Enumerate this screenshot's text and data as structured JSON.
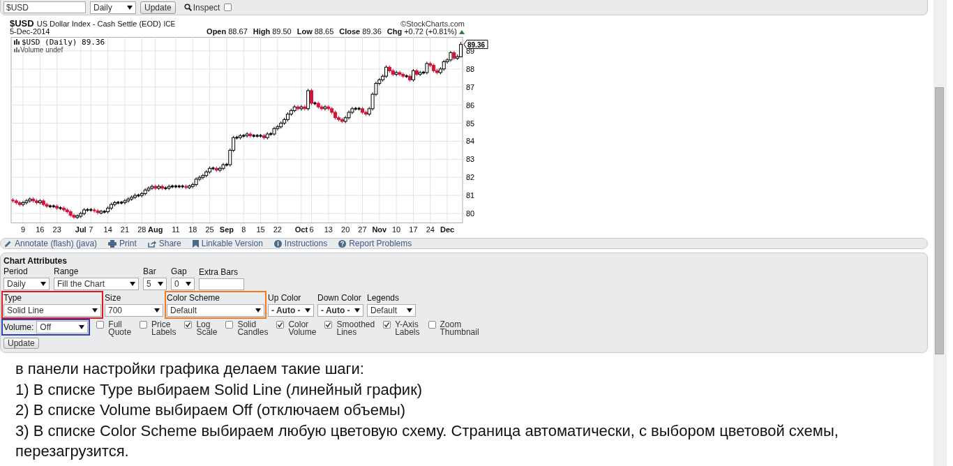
{
  "symbol_bar": {
    "symbol": "$USD",
    "period": "Daily",
    "update": "Update",
    "inspect": {
      "label": "Inspect",
      "checked": false
    }
  },
  "chart": {
    "symbol": "$USD",
    "name": "US Dollar Index - Cash Settle (EOD)",
    "exchange": "ICE",
    "credit": "©StockCharts.com",
    "date": "5-Dec-2014",
    "quote": [
      {
        "label": "Open",
        "value": "88.67"
      },
      {
        "label": "High",
        "value": "89.50"
      },
      {
        "label": "Low",
        "value": "88.65"
      },
      {
        "label": "Close",
        "value": "89.36"
      },
      {
        "label": "Chg",
        "value": "+0.72 (+0.81%)"
      }
    ],
    "change_up": true,
    "legend": "$USD (Daily) 89.36",
    "volume_legend": "Volume undef",
    "price_tag": "89.36",
    "chart_data": {
      "type": "candlestick",
      "grid": true,
      "ylim": [
        79.5,
        89.77
      ],
      "yticks": [
        80,
        81,
        82,
        83,
        84,
        85,
        86,
        87,
        88,
        89
      ],
      "categories": [
        null,
        null,
        null,
        "9",
        null,
        null,
        null,
        null,
        "16",
        null,
        null,
        null,
        null,
        "23",
        null,
        null,
        null,
        null,
        null,
        null,
        "**Jul**",
        null,
        null,
        "7",
        null,
        null,
        null,
        null,
        "14",
        null,
        null,
        null,
        null,
        "21",
        null,
        null,
        null,
        null,
        "28",
        null,
        null,
        null,
        "**Aug**",
        null,
        null,
        null,
        null,
        null,
        "11",
        null,
        null,
        null,
        null,
        "18",
        null,
        null,
        null,
        null,
        "25",
        null,
        null,
        null,
        null,
        "**Sep**",
        null,
        null,
        null,
        null,
        "8",
        null,
        null,
        null,
        null,
        "15",
        null,
        null,
        null,
        null,
        "22",
        null,
        null,
        null,
        null,
        null,
        null,
        "**Oct**",
        null,
        null,
        "6",
        null,
        null,
        null,
        null,
        "13",
        null,
        null,
        null,
        null,
        "20",
        null,
        null,
        null,
        null,
        "27",
        null,
        null,
        null,
        null,
        "**Nov**",
        null,
        null,
        null,
        null,
        "10",
        null,
        null,
        null,
        null,
        "17",
        null,
        null,
        null,
        null,
        "24",
        null,
        null,
        null,
        null,
        "**Dec**",
        null,
        null,
        null,
        null
      ],
      "ohlc": [
        [
          80.75,
          80.85,
          80.6,
          80.7
        ],
        [
          80.7,
          80.8,
          80.5,
          80.6
        ],
        [
          80.6,
          80.7,
          80.4,
          80.5
        ],
        [
          80.5,
          80.7,
          80.4,
          80.6
        ],
        [
          80.6,
          80.8,
          80.5,
          80.7
        ],
        [
          80.7,
          80.9,
          80.6,
          80.8
        ],
        [
          80.8,
          80.9,
          80.6,
          80.7
        ],
        [
          80.7,
          80.8,
          80.5,
          80.6
        ],
        [
          80.6,
          80.8,
          80.5,
          80.7
        ],
        [
          80.7,
          80.8,
          80.4,
          80.5
        ],
        [
          80.5,
          80.6,
          80.3,
          80.4
        ],
        [
          80.4,
          80.5,
          80.3,
          80.4
        ],
        [
          80.4,
          80.5,
          80.3,
          80.4
        ],
        [
          80.4,
          80.5,
          80.2,
          80.3
        ],
        [
          80.3,
          80.4,
          80.2,
          80.3
        ],
        [
          80.3,
          80.4,
          80.1,
          80.2
        ],
        [
          80.2,
          80.3,
          80.0,
          80.1
        ],
        [
          80.1,
          80.2,
          79.8,
          79.9
        ],
        [
          79.9,
          80.0,
          79.7,
          79.8
        ],
        [
          79.8,
          79.95,
          79.7,
          79.85
        ],
        [
          79.85,
          80.1,
          79.75,
          80.0
        ],
        [
          80.0,
          80.3,
          79.9,
          80.2
        ],
        [
          80.2,
          80.3,
          80.1,
          80.2
        ],
        [
          80.2,
          80.3,
          80.1,
          80.2
        ],
        [
          80.2,
          80.3,
          80.05,
          80.15
        ],
        [
          80.15,
          80.25,
          79.95,
          80.05
        ],
        [
          80.05,
          80.2,
          79.95,
          80.1
        ],
        [
          80.1,
          80.2,
          80.0,
          80.1
        ],
        [
          80.1,
          80.4,
          80.0,
          80.3
        ],
        [
          80.3,
          80.6,
          80.2,
          80.5
        ],
        [
          80.5,
          80.7,
          80.4,
          80.6
        ],
        [
          80.6,
          80.7,
          80.5,
          80.6
        ],
        [
          80.6,
          80.7,
          80.5,
          80.6
        ],
        [
          80.6,
          80.8,
          80.5,
          80.7
        ],
        [
          80.7,
          80.9,
          80.6,
          80.8
        ],
        [
          80.8,
          81.0,
          80.7,
          80.9
        ],
        [
          80.9,
          81.1,
          80.8,
          81.0
        ],
        [
          81.0,
          81.1,
          80.9,
          81.0
        ],
        [
          81.0,
          81.2,
          80.9,
          81.1
        ],
        [
          81.1,
          81.4,
          81.0,
          81.3
        ],
        [
          81.3,
          81.5,
          81.2,
          81.4
        ],
        [
          81.4,
          81.6,
          81.3,
          81.5
        ],
        [
          81.5,
          81.6,
          81.3,
          81.4
        ],
        [
          81.4,
          81.6,
          81.3,
          81.5
        ],
        [
          81.5,
          81.6,
          81.3,
          81.4
        ],
        [
          81.4,
          81.5,
          81.3,
          81.4
        ],
        [
          81.4,
          81.6,
          81.3,
          81.5
        ],
        [
          81.5,
          81.6,
          81.4,
          81.5
        ],
        [
          81.5,
          81.6,
          81.4,
          81.5
        ],
        [
          81.5,
          81.6,
          81.4,
          81.5
        ],
        [
          81.5,
          81.6,
          81.4,
          81.5
        ],
        [
          81.5,
          81.6,
          81.35,
          81.45
        ],
        [
          81.45,
          81.6,
          81.35,
          81.5
        ],
        [
          81.5,
          81.7,
          81.4,
          81.6
        ],
        [
          81.6,
          82.0,
          81.5,
          81.9
        ],
        [
          81.9,
          82.1,
          81.8,
          82.0
        ],
        [
          82.0,
          82.2,
          81.9,
          82.1
        ],
        [
          82.1,
          82.4,
          82.0,
          82.3
        ],
        [
          82.3,
          82.6,
          82.2,
          82.5
        ],
        [
          82.5,
          82.6,
          82.4,
          82.5
        ],
        [
          82.5,
          82.6,
          82.3,
          82.4
        ],
        [
          82.4,
          82.6,
          82.3,
          82.5
        ],
        [
          82.5,
          82.8,
          82.4,
          82.7
        ],
        [
          82.7,
          82.8,
          82.6,
          82.7
        ],
        [
          82.7,
          83.6,
          82.6,
          83.5
        ],
        [
          83.5,
          84.3,
          83.4,
          84.2
        ],
        [
          84.2,
          84.3,
          84.1,
          84.2
        ],
        [
          84.2,
          84.4,
          84.1,
          84.3
        ],
        [
          84.3,
          84.4,
          84.2,
          84.3
        ],
        [
          84.3,
          84.5,
          84.2,
          84.4
        ],
        [
          84.4,
          84.5,
          84.2,
          84.3
        ],
        [
          84.3,
          84.4,
          84.2,
          84.3
        ],
        [
          84.3,
          84.4,
          84.2,
          84.3
        ],
        [
          84.3,
          84.4,
          84.2,
          84.3
        ],
        [
          84.3,
          84.4,
          84.1,
          84.2
        ],
        [
          84.2,
          84.5,
          84.1,
          84.4
        ],
        [
          84.4,
          84.5,
          84.3,
          84.4
        ],
        [
          84.4,
          84.8,
          84.3,
          84.7
        ],
        [
          84.7,
          84.9,
          84.6,
          84.8
        ],
        [
          84.8,
          85.1,
          84.7,
          85.0
        ],
        [
          85.0,
          85.3,
          84.9,
          85.2
        ],
        [
          85.2,
          85.6,
          85.1,
          85.5
        ],
        [
          85.5,
          85.8,
          85.4,
          85.7
        ],
        [
          85.7,
          86.0,
          85.6,
          85.9
        ],
        [
          85.9,
          86.0,
          85.7,
          85.8
        ],
        [
          85.8,
          86.0,
          85.7,
          85.9
        ],
        [
          85.9,
          86.0,
          85.7,
          85.8
        ],
        [
          85.8,
          86.9,
          85.7,
          86.8
        ],
        [
          86.8,
          86.9,
          86.0,
          86.1
        ],
        [
          86.1,
          86.2,
          86.0,
          86.1
        ],
        [
          86.1,
          86.2,
          85.8,
          85.9
        ],
        [
          85.9,
          86.0,
          85.7,
          85.8
        ],
        [
          85.8,
          86.0,
          85.7,
          85.9
        ],
        [
          85.9,
          86.0,
          85.7,
          85.8
        ],
        [
          85.8,
          85.9,
          85.5,
          85.6
        ],
        [
          85.6,
          85.7,
          85.2,
          85.3
        ],
        [
          85.3,
          85.4,
          85.1,
          85.2
        ],
        [
          85.2,
          85.3,
          85.0,
          85.1
        ],
        [
          85.1,
          85.4,
          85.0,
          85.3
        ],
        [
          85.3,
          85.7,
          85.2,
          85.6
        ],
        [
          85.6,
          85.9,
          85.5,
          85.8
        ],
        [
          85.8,
          85.9,
          85.7,
          85.8
        ],
        [
          85.8,
          85.9,
          85.7,
          85.8
        ],
        [
          85.8,
          85.9,
          85.5,
          85.6
        ],
        [
          85.6,
          85.7,
          85.4,
          85.5
        ],
        [
          85.5,
          85.9,
          85.4,
          85.8
        ],
        [
          85.8,
          86.7,
          85.7,
          86.6
        ],
        [
          86.6,
          87.3,
          86.5,
          87.2
        ],
        [
          87.2,
          87.5,
          87.1,
          87.4
        ],
        [
          87.4,
          87.7,
          87.3,
          87.6
        ],
        [
          87.6,
          88.2,
          87.5,
          88.1
        ],
        [
          88.1,
          88.2,
          87.8,
          87.9
        ],
        [
          87.9,
          88.0,
          87.6,
          87.7
        ],
        [
          87.7,
          87.9,
          87.6,
          87.8
        ],
        [
          87.8,
          87.9,
          87.6,
          87.7
        ],
        [
          87.7,
          87.8,
          87.5,
          87.6
        ],
        [
          87.6,
          87.7,
          87.5,
          87.6
        ],
        [
          87.6,
          87.7,
          87.3,
          87.4
        ],
        [
          87.4,
          88.0,
          87.3,
          87.9
        ],
        [
          87.9,
          88.0,
          87.6,
          87.7
        ],
        [
          87.7,
          87.9,
          87.6,
          87.8
        ],
        [
          87.8,
          87.9,
          87.7,
          87.8
        ],
        [
          87.8,
          88.4,
          87.7,
          88.3
        ],
        [
          88.3,
          88.4,
          88.1,
          88.2
        ],
        [
          88.2,
          88.3,
          87.8,
          87.9
        ],
        [
          87.9,
          88.0,
          87.7,
          87.8
        ],
        [
          87.8,
          88.1,
          87.7,
          88.0
        ],
        [
          88.0,
          88.5,
          87.9,
          88.4
        ],
        [
          88.4,
          88.6,
          88.3,
          88.5
        ],
        [
          88.5,
          89.0,
          88.4,
          88.9
        ],
        [
          88.9,
          89.0,
          88.5,
          88.6
        ],
        [
          88.6,
          88.8,
          88.5,
          88.67
        ],
        [
          88.67,
          89.5,
          88.65,
          89.36
        ]
      ]
    }
  },
  "toolbar": [
    "Annotate (flash) (java)",
    "Print",
    "Share",
    "Linkable Version",
    "Instructions",
    "Report Problems"
  ],
  "attributes": {
    "title": "Chart Attributes",
    "row_1": [
      {
        "kind": "select",
        "label": "Period",
        "value": "Daily"
      },
      {
        "kind": "select",
        "label": "Range",
        "value": "Fill the Chart"
      },
      {
        "kind": "select",
        "label": "Bar",
        "value": "5"
      },
      {
        "kind": "select",
        "label": "Gap",
        "value": "0"
      },
      {
        "kind": "input",
        "label": "Extra Bars"
      }
    ],
    "row_2": [
      {
        "kind": "select",
        "label": "Type",
        "value": "Solid Line",
        "color": "#e8141b"
      },
      {
        "kind": "select",
        "label": "Size",
        "value": "700"
      },
      {
        "kind": "select",
        "label": "Color Scheme",
        "value": "Default",
        "color": "#f47b20"
      },
      {
        "kind": "select",
        "label": "Up Color",
        "value": "**- Auto -**"
      },
      {
        "kind": "select",
        "label": "Down Color",
        "value": "**- Auto -**"
      },
      {
        "kind": "select",
        "label": "Legends",
        "value": "Default"
      }
    ],
    "volume": {
      "label": "Volume:",
      "value": "Off",
      "color": "#2f3fbf"
    },
    "options": [
      {
        "label": "Full Quote",
        "checked": false
      },
      {
        "label": "Price Labels",
        "checked": false
      },
      {
        "label": "Log Scale",
        "checked": true
      },
      {
        "label": "Solid Candles",
        "checked": false
      },
      {
        "label": "Color Volume",
        "checked": true
      },
      {
        "label": "Smoothed Lines",
        "checked": true
      },
      {
        "label": "Y-Axis Labels",
        "checked": true
      },
      {
        "label": "Zoom Thumbnail",
        "checked": false
      }
    ],
    "update": "Update"
  },
  "instructions": [
    "в панели настройки графика делаем такие шаги:",
    "1) В списке Type выбираем Solid Line (линейный график)",
    "2) В списке Volume выбираем Off (отключаем объемы)",
    "3) В списке Color Scheme выбираем любую цветовую схему. Страница автоматически, с выбором цветовой схемы, перезагрузится."
  ]
}
